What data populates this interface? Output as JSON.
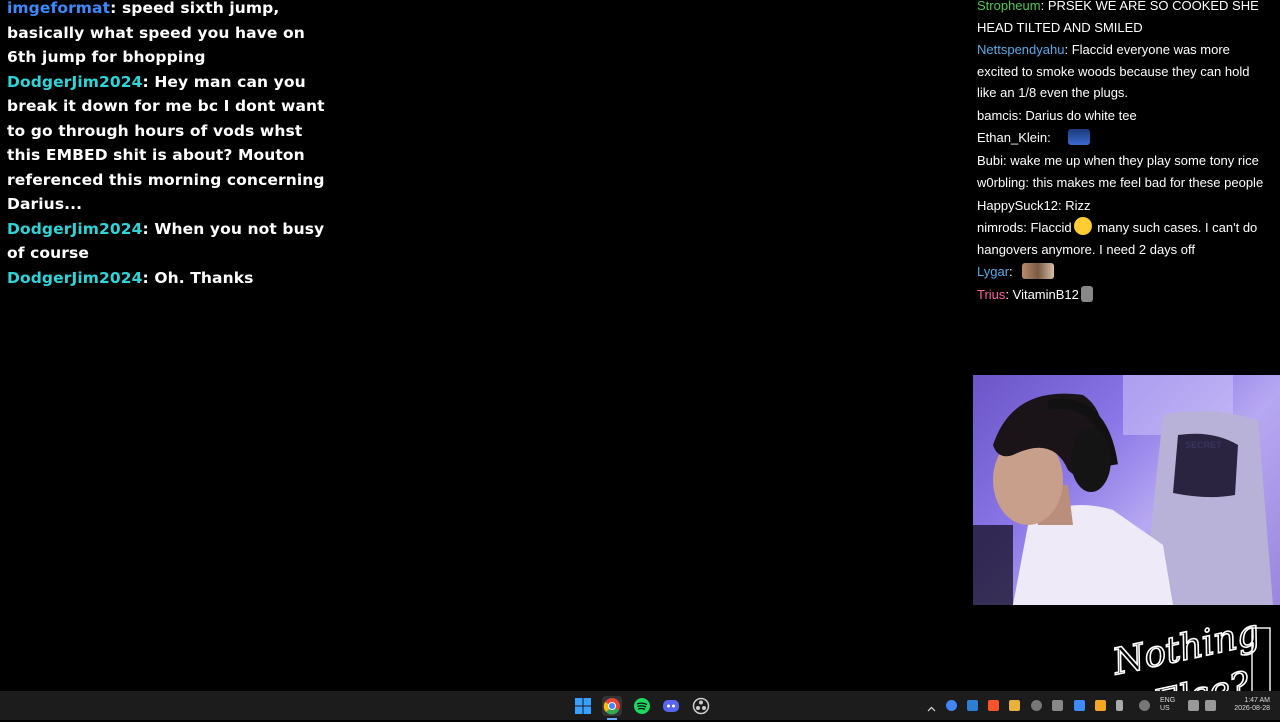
{
  "left_chat": [
    {
      "user": "imgeformat",
      "color": "#3d8bff",
      "text": "speed sixth jump, basically what speed you have on 6th jump for bhopping"
    },
    {
      "user": "DodgerJim2024",
      "color": "#2fd4d8",
      "text": "Hey man can you break it down for me bc I dont want to go through hours of vods whst this EMBED shit is about? Mouton referenced this morning concerning Darius..."
    },
    {
      "user": "DodgerJim2024",
      "color": "#2fd4d8",
      "text": "When you not busy of course"
    },
    {
      "user": "DodgerJim2024",
      "color": "#2fd4d8",
      "text": "Oh. Thanks"
    }
  ],
  "right_chat": [
    {
      "user": "Stropheum",
      "color": "#4ec94e",
      "text": "PRSEK WE ARE SO COOKED SHE HEAD TILTED AND SMILED",
      "emote": ""
    },
    {
      "user": "Nettspendyahu",
      "color": "#5aa9e6",
      "text": "Flaccid everyone was more excited to smoke woods because they can hold like an 1/8 even the plugs.",
      "emote": ""
    },
    {
      "user": "bamcis",
      "color": "#ffffff",
      "text": "Darius do white tee",
      "emote": ""
    },
    {
      "user": "Ethan_Klein",
      "color": "#ffffff",
      "text": "",
      "emote": "person-emote"
    },
    {
      "user": "Bubi",
      "color": "#ffffff",
      "text": "wake me up when they play some tony rice",
      "emote": ""
    },
    {
      "user": "w0rbling",
      "color": "#ffffff",
      "text": "this makes me feel bad for these people",
      "emote": ""
    },
    {
      "user": "HappySuck12",
      "color": "#ffffff",
      "text": "Rizz",
      "emote": ""
    },
    {
      "user": "nimrods",
      "color": "#ffffff",
      "text_before": "Flaccid",
      "text": "many such cases. I can't do hangovers anymore. I need 2 days off",
      "emote": "kiss-emote"
    },
    {
      "user": "Lygar",
      "color": "#5aa9e6",
      "text": "",
      "emote": "photo-emote"
    },
    {
      "user": "Trius",
      "color": "#ff5fa2",
      "text": "VitaminB12",
      "emote": "statue-emote"
    }
  ],
  "logo": {
    "line1": "Nothing",
    "line2": "Else?"
  },
  "tray": {
    "lang": "ENG",
    "region": "US",
    "time": "1:47 AM",
    "date": "2026-08-28"
  },
  "colors": {
    "taskbar": "#1c1c1c",
    "accent_blue": "#3d8bff",
    "accent_cyan": "#2fd4d8"
  }
}
